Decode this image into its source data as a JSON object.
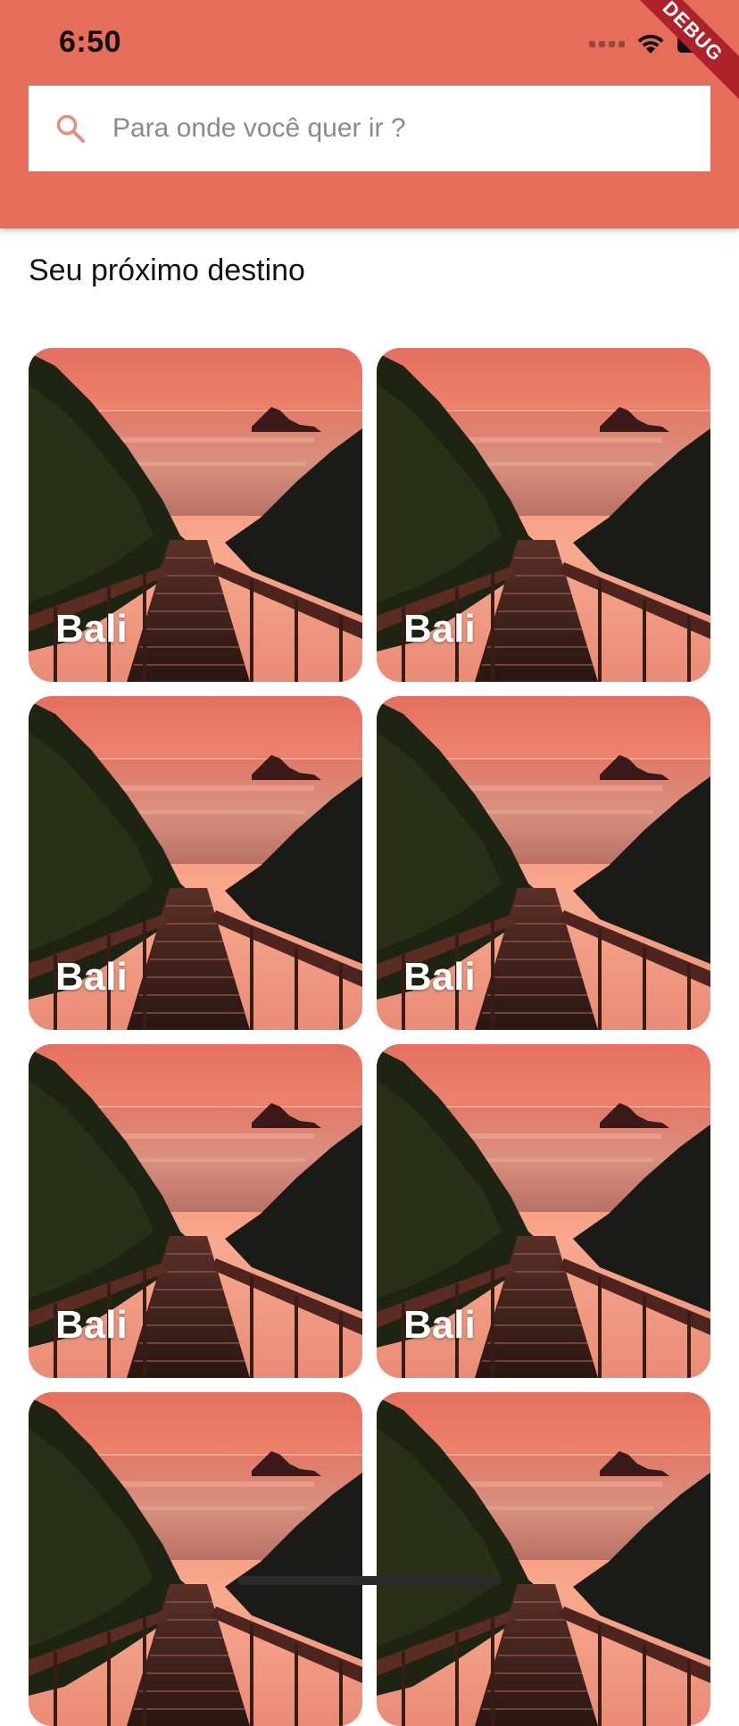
{
  "status_bar": {
    "time": "6:50"
  },
  "debug_banner": "DEBUG",
  "search": {
    "placeholder": "Para onde você quer ir ?",
    "value": ""
  },
  "section": {
    "title": "Seu próximo destino"
  },
  "destinations": [
    {
      "label": "Bali"
    },
    {
      "label": "Bali"
    },
    {
      "label": "Bali"
    },
    {
      "label": "Bali"
    },
    {
      "label": "Bali"
    },
    {
      "label": "Bali"
    },
    {
      "label": ""
    },
    {
      "label": ""
    }
  ],
  "colors": {
    "appbar": "#e76d5b",
    "search_icon": "#ee8a7a",
    "debug_banner": "#b0222a"
  },
  "icons": {
    "search": "search-icon",
    "wifi": "wifi-icon",
    "battery": "battery-icon",
    "signal": "signal-icon"
  }
}
